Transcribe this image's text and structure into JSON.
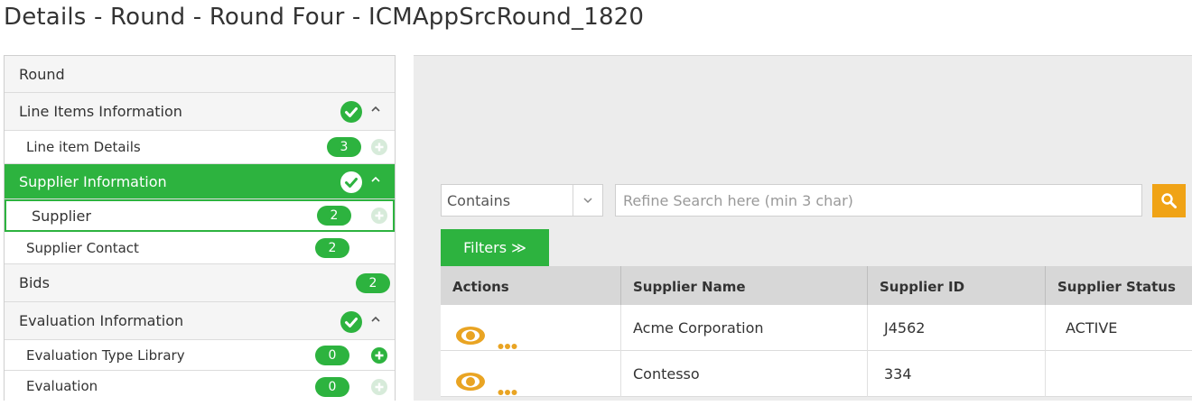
{
  "page_title": "Details - Round - Round Four - ICMAppSrcRound_1820",
  "sidebar": {
    "round_label": "Round",
    "line_items_info": {
      "label": "Line Items Information"
    },
    "line_item_details": {
      "label": "Line item Details",
      "count": "3"
    },
    "supplier_info": {
      "label": "Supplier Information"
    },
    "supplier": {
      "label": "Supplier",
      "count": "2"
    },
    "supplier_contact": {
      "label": "Supplier Contact",
      "count": "2"
    },
    "bids": {
      "label": "Bids",
      "count": "2"
    },
    "evaluation_info": {
      "label": "Evaluation Information"
    },
    "evaluation_type_library": {
      "label": "Evaluation Type Library",
      "count": "0"
    },
    "evaluation": {
      "label": "Evaluation",
      "count": "0"
    }
  },
  "search": {
    "operator": "Contains",
    "placeholder": "Refine Search here (min 3 char)",
    "value": ""
  },
  "filters_label": "Filters ≫",
  "table": {
    "headers": [
      "Actions",
      "Supplier Name",
      "Supplier ID",
      "Supplier Status"
    ],
    "rows": [
      {
        "name": "Acme Corporation",
        "id": "J4562",
        "status": "ACTIVE"
      },
      {
        "name": "Contesso",
        "id": "334",
        "status": ""
      }
    ]
  },
  "colors": {
    "accent_green": "#2db33f",
    "search_orange": "#f0a316",
    "eye_orange": "#e9a423"
  },
  "icons": [
    "check-circle-icon",
    "chevron-up-icon",
    "plus-circle-icon",
    "chevron-down-icon",
    "search-icon",
    "eye-icon",
    "more-dots-icon"
  ]
}
